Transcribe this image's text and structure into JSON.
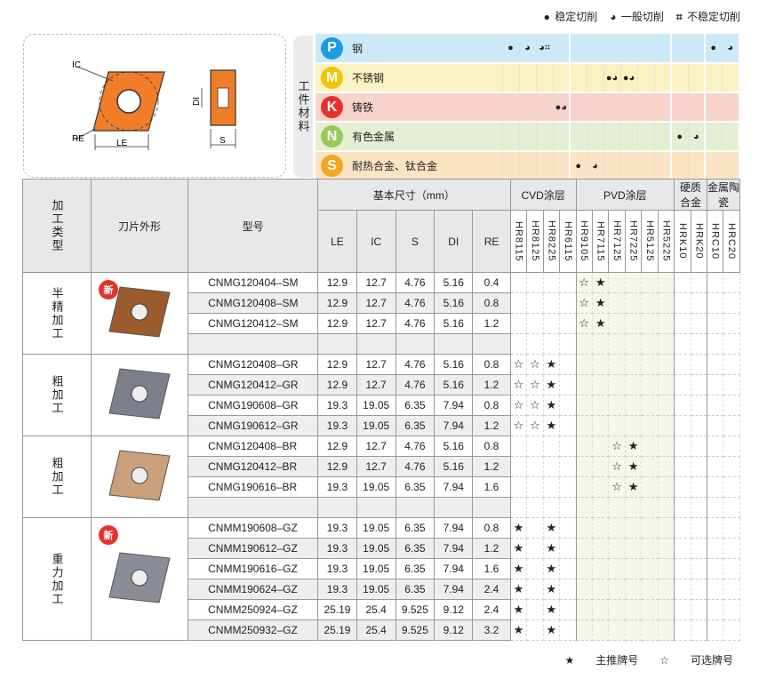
{
  "legend_top": [
    {
      "symbol": "●",
      "label": "稳定切削"
    },
    {
      "symbol": "◕",
      "label": "一般切削"
    },
    {
      "symbol": "⌗",
      "label": "不稳定切削"
    }
  ],
  "diagram": {
    "labels": {
      "ic": "IC",
      "re": "RE",
      "le": "LE",
      "di": "DI",
      "s": "S"
    },
    "insert_color": "#f07d27"
  },
  "workpiece": {
    "label": "工件材料",
    "materials": [
      {
        "letter": "P",
        "name": "钢",
        "badge_color": "#1b9be0",
        "bg": "#cde9f8"
      },
      {
        "letter": "M",
        "name": "不锈钢",
        "badge_color": "#f5c400",
        "bg": "#fbf2c4"
      },
      {
        "letter": "K",
        "name": "铸铁",
        "badge_color": "#e5322c",
        "bg": "#f8d3cb"
      },
      {
        "letter": "N",
        "name": "有色金属",
        "badge_color": "#9bc85a",
        "bg": "#e4efd3"
      },
      {
        "letter": "S",
        "name": "耐热合金、钛合金",
        "badge_color": "#f5a623",
        "bg": "#fbe4c3"
      }
    ],
    "grid": [
      [
        "●",
        "◕",
        "◕⌗",
        "",
        "",
        "",
        "",
        "",
        "",
        "",
        "",
        "",
        "●",
        "◕"
      ],
      [
        "",
        "",
        "",
        "",
        "",
        "",
        "●◕",
        "●◕",
        "",
        "",
        "",
        "",
        "",
        ""
      ],
      [
        "",
        "",
        "",
        "●◕",
        "",
        "",
        "",
        "",
        "",
        "",
        "",
        "",
        "",
        ""
      ],
      [
        "",
        "",
        "",
        "",
        "",
        "",
        "",
        "",
        "",
        "",
        "●",
        "◕",
        "",
        ""
      ],
      [
        "",
        "",
        "",
        "",
        "●",
        "◕",
        "",
        "",
        "",
        "",
        "",
        "",
        "",
        ""
      ]
    ]
  },
  "table": {
    "headers": {
      "category": "加工类型",
      "shape": "刀片外形",
      "model": "型号",
      "dims": "基本尺寸（mm）",
      "cvd": "CVD涂层",
      "pvd": "PVD涂层",
      "carbide": "硬质合金",
      "cermet": "金属陶瓷",
      "dim_cols": [
        "LE",
        "IC",
        "S",
        "DI",
        "RE"
      ]
    },
    "grades": [
      "HR8115",
      "HR8125",
      "HR8225",
      "HR6115",
      "HR9105",
      "HR7115",
      "HR7125",
      "HR7225",
      "HR5125",
      "HR5225",
      "HRK10",
      "HRK20",
      "HRC10",
      "HRC20"
    ],
    "groups": [
      {
        "category": "半精加工",
        "new_badge": "新",
        "insert_color": "#9a5b2d",
        "rows": [
          {
            "model": "CNMG120404–SM",
            "LE": "12.9",
            "IC": "12.7",
            "S": "4.76",
            "DI": "5.16",
            "RE": "0.4",
            "marks": [
              "",
              "",
              "",
              "",
              "☆",
              "★",
              "",
              "",
              "",
              "",
              "",
              "",
              "",
              ""
            ]
          },
          {
            "model": "CNMG120408–SM",
            "LE": "12.9",
            "IC": "12.7",
            "S": "4.76",
            "DI": "5.16",
            "RE": "0.8",
            "marks": [
              "",
              "",
              "",
              "",
              "☆",
              "★",
              "",
              "",
              "",
              "",
              "",
              "",
              "",
              ""
            ]
          },
          {
            "model": "CNMG120412–SM",
            "LE": "12.9",
            "IC": "12.7",
            "S": "4.76",
            "DI": "5.16",
            "RE": "1.2",
            "marks": [
              "",
              "",
              "",
              "",
              "☆",
              "★",
              "",
              "",
              "",
              "",
              "",
              "",
              "",
              ""
            ]
          },
          {
            "model": "",
            "LE": "",
            "IC": "",
            "S": "",
            "DI": "",
            "RE": "",
            "marks": [
              "",
              "",
              "",
              "",
              "",
              "",
              "",
              "",
              "",
              "",
              "",
              "",
              "",
              ""
            ]
          }
        ]
      },
      {
        "category": "粗加工",
        "new_badge": "",
        "insert_color": "#7e7f8c",
        "rows": [
          {
            "model": "CNMG120408–GR",
            "LE": "12.9",
            "IC": "12.7",
            "S": "4.76",
            "DI": "5.16",
            "RE": "0.8",
            "marks": [
              "☆",
              "☆",
              "★",
              "",
              "",
              "",
              "",
              "",
              "",
              "",
              "",
              "",
              "",
              ""
            ]
          },
          {
            "model": "CNMG120412–GR",
            "LE": "12.9",
            "IC": "12.7",
            "S": "4.76",
            "DI": "5.16",
            "RE": "1.2",
            "marks": [
              "☆",
              "☆",
              "★",
              "",
              "",
              "",
              "",
              "",
              "",
              "",
              "",
              "",
              "",
              ""
            ]
          },
          {
            "model": "CNMG190608–GR",
            "LE": "19.3",
            "IC": "19.05",
            "S": "6.35",
            "DI": "7.94",
            "RE": "0.8",
            "marks": [
              "☆",
              "☆",
              "★",
              "",
              "",
              "",
              "",
              "",
              "",
              "",
              "",
              "",
              "",
              ""
            ]
          },
          {
            "model": "CNMG190612–GR",
            "LE": "19.3",
            "IC": "19.05",
            "S": "6.35",
            "DI": "7.94",
            "RE": "1.2",
            "marks": [
              "☆",
              "☆",
              "★",
              "",
              "",
              "",
              "",
              "",
              "",
              "",
              "",
              "",
              "",
              ""
            ]
          }
        ]
      },
      {
        "category": "粗加工",
        "new_badge": "",
        "insert_color": "#c9a07a",
        "rows": [
          {
            "model": "CNMG120408–BR",
            "LE": "12.9",
            "IC": "12.7",
            "S": "4.76",
            "DI": "5.16",
            "RE": "0.8",
            "marks": [
              "",
              "",
              "",
              "",
              "",
              "",
              "☆",
              "★",
              "",
              "",
              "",
              "",
              "",
              ""
            ]
          },
          {
            "model": "CNMG120412–BR",
            "LE": "12.9",
            "IC": "12.7",
            "S": "4.76",
            "DI": "5.16",
            "RE": "1.2",
            "marks": [
              "",
              "",
              "",
              "",
              "",
              "",
              "☆",
              "★",
              "",
              "",
              "",
              "",
              "",
              ""
            ]
          },
          {
            "model": "CNMG190616–BR",
            "LE": "19.3",
            "IC": "19.05",
            "S": "6.35",
            "DI": "7.94",
            "RE": "1.6",
            "marks": [
              "",
              "",
              "",
              "",
              "",
              "",
              "☆",
              "★",
              "",
              "",
              "",
              "",
              "",
              ""
            ]
          },
          {
            "model": "",
            "LE": "",
            "IC": "",
            "S": "",
            "DI": "",
            "RE": "",
            "marks": [
              "",
              "",
              "",
              "",
              "",
              "",
              "",
              "",
              "",
              "",
              "",
              "",
              "",
              ""
            ]
          }
        ]
      },
      {
        "category": "重力加工",
        "new_badge": "新",
        "insert_color": "#8a8d97",
        "rows": [
          {
            "model": "CNMM190608–GZ",
            "LE": "19.3",
            "IC": "19.05",
            "S": "6.35",
            "DI": "7.94",
            "RE": "0.8",
            "marks": [
              "★",
              "",
              "★",
              "",
              "",
              "",
              "",
              "",
              "",
              "",
              "",
              "",
              "",
              ""
            ]
          },
          {
            "model": "CNMM190612–GZ",
            "LE": "19.3",
            "IC": "19.05",
            "S": "6.35",
            "DI": "7.94",
            "RE": "1.2",
            "marks": [
              "★",
              "",
              "★",
              "",
              "",
              "",
              "",
              "",
              "",
              "",
              "",
              "",
              "",
              ""
            ]
          },
          {
            "model": "CNMM190616–GZ",
            "LE": "19.3",
            "IC": "19.05",
            "S": "6.35",
            "DI": "7.94",
            "RE": "1.6",
            "marks": [
              "★",
              "",
              "★",
              "",
              "",
              "",
              "",
              "",
              "",
              "",
              "",
              "",
              "",
              ""
            ]
          },
          {
            "model": "CNMM190624–GZ",
            "LE": "19.3",
            "IC": "19.05",
            "S": "6.35",
            "DI": "7.94",
            "RE": "2.4",
            "marks": [
              "★",
              "",
              "★",
              "",
              "",
              "",
              "",
              "",
              "",
              "",
              "",
              "",
              "",
              ""
            ]
          },
          {
            "model": "CNMM250924–GZ",
            "LE": "25.19",
            "IC": "25.4",
            "S": "9.525",
            "DI": "9.12",
            "RE": "2.4",
            "marks": [
              "★",
              "",
              "★",
              "",
              "",
              "",
              "",
              "",
              "",
              "",
              "",
              "",
              "",
              ""
            ]
          },
          {
            "model": "CNMM250932–GZ",
            "LE": "25.19",
            "IC": "25.4",
            "S": "9.525",
            "DI": "9.12",
            "RE": "3.2",
            "marks": [
              "★",
              "",
              "★",
              "",
              "",
              "",
              "",
              "",
              "",
              "",
              "",
              "",
              "",
              ""
            ]
          }
        ]
      }
    ]
  },
  "legend_bottom": [
    {
      "symbol": "★",
      "label": "主推牌号"
    },
    {
      "symbol": "☆",
      "label": "可选牌号"
    }
  ]
}
